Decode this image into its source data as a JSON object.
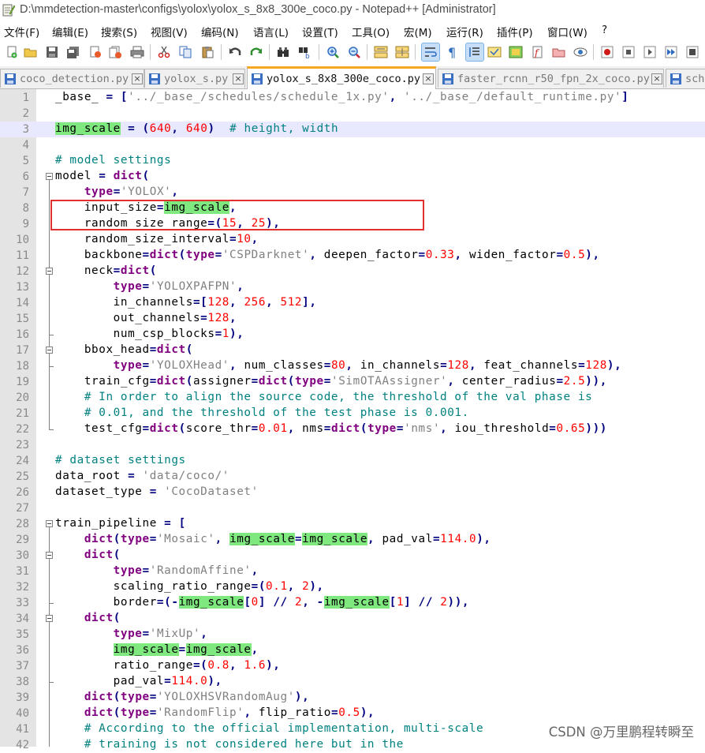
{
  "window": {
    "title": "D:\\mmdetection-master\\configs\\yolox\\yolox_s_8x8_300e_coco.py - Notepad++ [Administrator]"
  },
  "menu": [
    "文件(F)",
    "编辑(E)",
    "搜索(S)",
    "视图(V)",
    "编码(N)",
    "语言(L)",
    "设置(T)",
    "工具(O)",
    "宏(M)",
    "运行(R)",
    "插件(P)",
    "窗口(W)",
    "?"
  ],
  "toolbar": {
    "buttons": [
      "new-file",
      "open-file",
      "save",
      "save-all",
      "close",
      "close-all",
      "print",
      "cut",
      "copy",
      "paste",
      "undo",
      "redo",
      "find",
      "replace",
      "zoom-in",
      "zoom-out",
      "sync-vertical",
      "sync-horizontal",
      "word-wrap",
      "show-all-chars",
      "indent-guide",
      "user-defined-language",
      "document-map",
      "function-list",
      "folder-as-workspace",
      "monitoring",
      "record-macro",
      "stop-recording",
      "playback-macro",
      "run-macro-multiple"
    ]
  },
  "tabs": [
    {
      "label": "coco_detection.py",
      "active": false
    },
    {
      "label": "yolox_s.py",
      "active": false
    },
    {
      "label": "yolox_s_8x8_300e_coco.py",
      "active": true
    },
    {
      "label": "faster_rcnn_r50_fpn_2x_coco.py",
      "active": false
    },
    {
      "label": "sch",
      "active": false
    }
  ],
  "editor": {
    "current_line": 3,
    "lines": [
      "_base_ = ['../_base_/schedules/schedule_1x.py', '../_base_/default_runtime.py']",
      "",
      "img_scale = (640, 640)  # height, width",
      "",
      "# model settings",
      "model = dict(",
      "    type='YOLOX',",
      "    input_size=img_scale,",
      "    random_size_range=(15, 25),",
      "    random_size_interval=10,",
      "    backbone=dict(type='CSPDarknet', deepen_factor=0.33, widen_factor=0.5),",
      "    neck=dict(",
      "        type='YOLOXPAFPN',",
      "        in_channels=[128, 256, 512],",
      "        out_channels=128,",
      "        num_csp_blocks=1),",
      "    bbox_head=dict(",
      "        type='YOLOXHead', num_classes=80, in_channels=128, feat_channels=128),",
      "    train_cfg=dict(assigner=dict(type='SimOTAAssigner', center_radius=2.5)),",
      "    # In order to align the source code, the threshold of the val phase is",
      "    # 0.01, and the threshold of the test phase is 0.001.",
      "    test_cfg=dict(score_thr=0.01, nms=dict(type='nms', iou_threshold=0.65)))",
      "",
      "# dataset settings",
      "data_root = 'data/coco/'",
      "dataset_type = 'CocoDataset'",
      "",
      "train_pipeline = [",
      "    dict(type='Mosaic', img_scale=img_scale, pad_val=114.0),",
      "    dict(",
      "        type='RandomAffine',",
      "        scaling_ratio_range=(0.1, 2),",
      "        border=(-img_scale[0] // 2, -img_scale[1] // 2)),",
      "    dict(",
      "        type='MixUp',",
      "        img_scale=img_scale,",
      "        ratio_range=(0.8, 1.6),",
      "        pad_val=114.0),",
      "    dict(type='YOLOXHSVRandomAug'),",
      "    dict(type='RandomFlip', flip_ratio=0.5),",
      "    # According to the official implementation, multi-scale",
      "    # training is not considered here but in the"
    ]
  },
  "watermark": "CSDN @万里鹏程转瞬至",
  "colors": {
    "keyword": "#800080",
    "string": "#808080",
    "number": "#ff0000",
    "comment": "#008080",
    "highlight": "#7fe87f",
    "annotation_box": "#e03030",
    "active_tab_accent": "#f5a623"
  }
}
